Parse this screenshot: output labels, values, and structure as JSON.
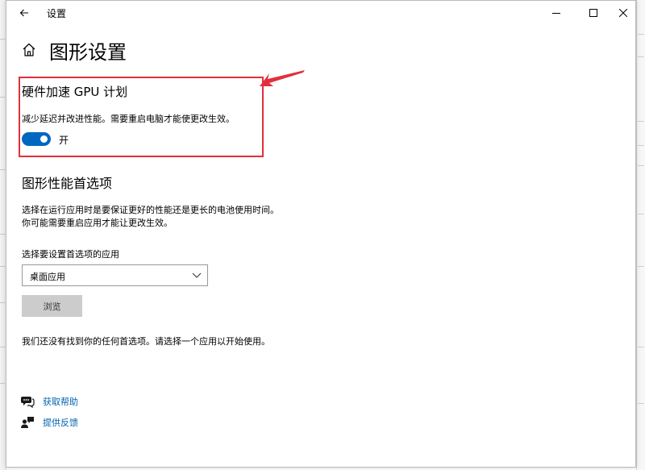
{
  "window": {
    "title": "设置",
    "back_icon": "back-arrow-icon",
    "controls": [
      "minimize-icon",
      "maximize-icon",
      "close-icon"
    ]
  },
  "page": {
    "home_icon": "home-icon",
    "title": "图形设置"
  },
  "hardware_gpu": {
    "title": "硬件加速 GPU 计划",
    "description": "减少延迟并改进性能。需要重启电脑才能使更改生效。",
    "toggle_state": "on",
    "toggle_label": "开",
    "accent_color": "#0067c0",
    "highlight_color": "#e0303c"
  },
  "graphics_pref": {
    "title": "图形性能首选项",
    "desc_line1": "选择在运行应用时是要保证更好的性能还是更长的电池使用时间。",
    "desc_line2": "你可能需要重启应用才能让更改生效。",
    "app_select_label": "选择要设置首选项的应用",
    "app_select_value": "桌面应用",
    "browse_label": "浏览",
    "empty_message": "我们还没有找到你的任何首选项。请选择一个应用以开始使用。"
  },
  "links": [
    {
      "icon": "help-chat-icon",
      "label": "获取帮助"
    },
    {
      "icon": "feedback-person-icon",
      "label": "提供反馈"
    }
  ]
}
